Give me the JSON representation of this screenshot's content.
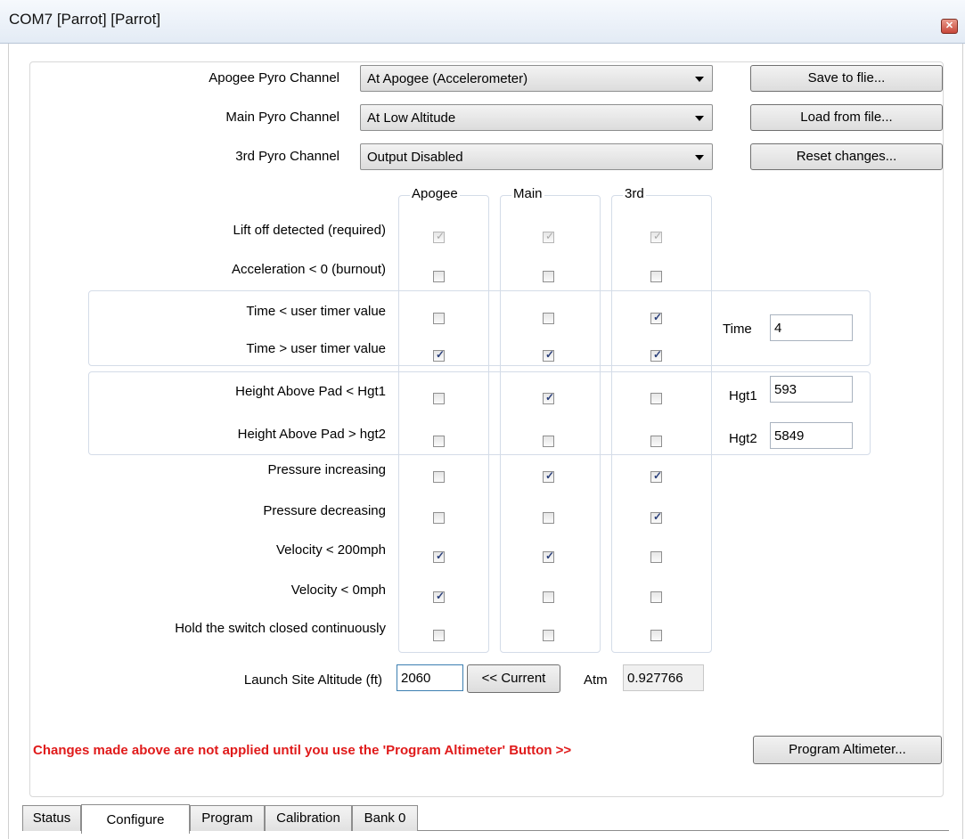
{
  "window": {
    "title": "COM7 [Parrot] [Parrot]"
  },
  "pyro": [
    {
      "label": "Apogee Pyro Channel",
      "value": "At Apogee (Accelerometer)"
    },
    {
      "label": "Main Pyro Channel",
      "value": "At Low Altitude"
    },
    {
      "label": "3rd Pyro Channel",
      "value": "Output Disabled"
    }
  ],
  "buttons": {
    "save": "Save to flie...",
    "load": "Load from file...",
    "reset": "Reset changes...",
    "current": "<< Current",
    "program": "Program Altimeter..."
  },
  "columns": [
    "Apogee",
    "Main",
    "3rd"
  ],
  "conditions": [
    {
      "label": "Lift off detected (required)",
      "checks": [
        true,
        true,
        true
      ],
      "disabled": true
    },
    {
      "label": "Acceleration < 0 (burnout)",
      "checks": [
        false,
        false,
        false
      ]
    },
    {
      "label": "Time < user timer value",
      "checks": [
        false,
        false,
        true
      ]
    },
    {
      "label": "Time > user timer value",
      "checks": [
        true,
        true,
        true
      ]
    },
    {
      "label": "Height Above Pad < Hgt1",
      "checks": [
        false,
        true,
        false
      ]
    },
    {
      "label": "Height Above Pad > hgt2",
      "checks": [
        false,
        false,
        false
      ]
    },
    {
      "label": "Pressure increasing",
      "checks": [
        false,
        true,
        true
      ]
    },
    {
      "label": "Pressure decreasing",
      "checks": [
        false,
        false,
        true
      ]
    },
    {
      "label": "Velocity < 200mph",
      "checks": [
        true,
        true,
        false
      ]
    },
    {
      "label": "Velocity < 0mph",
      "checks": [
        true,
        false,
        false
      ]
    },
    {
      "label": "Hold the switch closed continuously",
      "checks": [
        false,
        false,
        false
      ]
    }
  ],
  "timer": {
    "label": "Time",
    "value": "4"
  },
  "hgt1": {
    "label": "Hgt1",
    "value": "593"
  },
  "hgt2": {
    "label": "Hgt2",
    "value": "5849"
  },
  "launch_site": {
    "label": "Launch Site Altitude (ft)",
    "value": "2060"
  },
  "atm": {
    "label": "Atm",
    "value": "0.927766"
  },
  "warning": "Changes made above are not applied until you use the 'Program Altimeter' Button >>",
  "tabs": [
    "Status",
    "Configure",
    "Program",
    "Calibration",
    "Bank 0"
  ],
  "active_tab": "Configure"
}
